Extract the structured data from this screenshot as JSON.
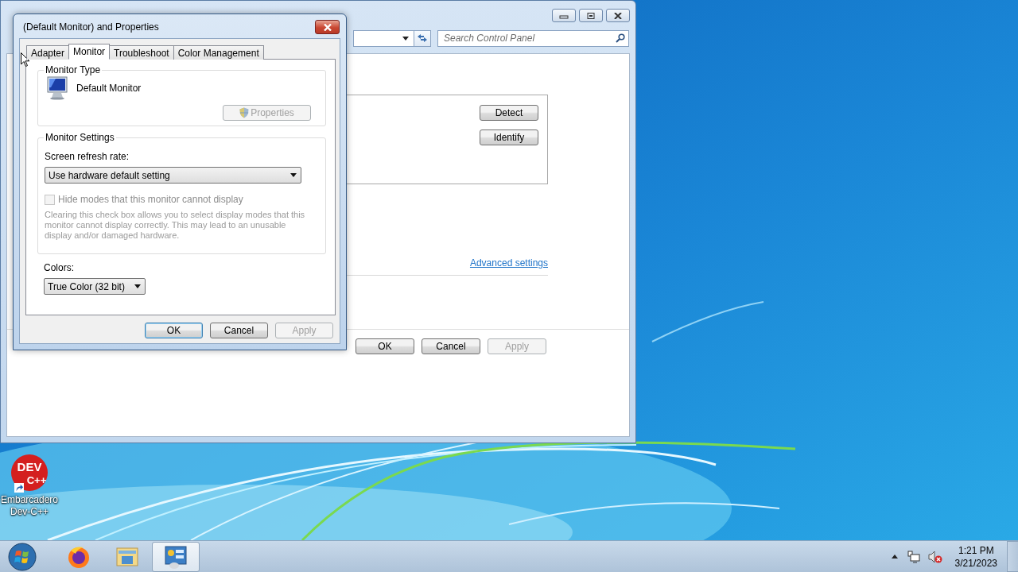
{
  "back_window": {
    "search": {
      "placeholder": "Search Control Panel"
    },
    "display_buttons": [
      {
        "label": "Detect",
        "disabled": false
      },
      {
        "label": "Identify",
        "disabled": false
      }
    ],
    "link": "Advanced settings",
    "buttons": [
      {
        "label": "OK",
        "disabled": false
      },
      {
        "label": "Cancel",
        "disabled": false
      },
      {
        "label": "Apply",
        "disabled": true
      }
    ]
  },
  "dialog": {
    "title": "(Default Monitor) and  Properties",
    "tabs": [
      {
        "label": "Adapter",
        "selected": false
      },
      {
        "label": "Monitor",
        "selected": true
      },
      {
        "label": "Troubleshoot",
        "selected": false
      },
      {
        "label": "Color Management",
        "selected": false
      }
    ],
    "monitor_type": {
      "heading": "Monitor Type",
      "name": "Default Monitor",
      "properties_button": {
        "label": "Properties",
        "disabled": true
      }
    },
    "monitor_settings": {
      "heading": "Monitor Settings",
      "refresh_label": "Screen refresh rate:",
      "refresh_value": "Use hardware default setting",
      "hide_modes": {
        "label": "Hide modes that this monitor cannot display",
        "checked": false,
        "disabled": true
      },
      "description": "Clearing this check box allows you to select display modes that this monitor cannot display correctly. This may lead to an unusable display and/or damaged hardware."
    },
    "colors": {
      "label": "Colors:",
      "value": "True Color (32 bit)"
    },
    "buttons": [
      {
        "label": "OK",
        "default": true,
        "disabled": false
      },
      {
        "label": "Cancel",
        "default": false,
        "disabled": false
      },
      {
        "label": "Apply",
        "default": false,
        "disabled": true
      }
    ]
  },
  "desktop_icons": [
    {
      "logo_lines": [
        "DEV",
        "C++"
      ],
      "label": "Embarcadero Dev-C++"
    }
  ],
  "taskbar": {
    "apps": [
      {
        "kind": "browser",
        "selected": false
      },
      {
        "kind": "folder",
        "selected": false
      },
      {
        "kind": "control-panel",
        "selected": true
      }
    ],
    "volume_muted": true,
    "time": "1:21 PM",
    "date": "3/21/2023"
  }
}
